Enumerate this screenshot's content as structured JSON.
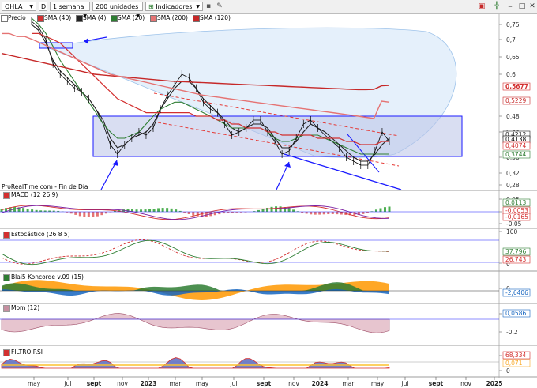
{
  "toolbar": {
    "symbol": "OHLA",
    "d_label": "D",
    "period": "1 semana",
    "units": "200 unidades",
    "indicators": "Indicadores"
  },
  "legend": [
    {
      "label": "Precio",
      "color": "#000000"
    },
    {
      "label": "SMA (40)",
      "color": "#d32f2f"
    },
    {
      "label": "SMA (4)",
      "color": "#222222"
    },
    {
      "label": "SMA (20)",
      "color": "#2e7d32"
    },
    {
      "label": "SMA (200)",
      "color": "#e57373"
    },
    {
      "label": "SMA (120)",
      "color": "#c62828"
    }
  ],
  "source_label": "ProRealTime.com - Fin de Día",
  "x_axis_labels": [
    "may",
    "jul",
    "sept",
    "nov",
    "2023",
    "mar",
    "may",
    "jul",
    "sept",
    "nov",
    "2024",
    "mar",
    "may",
    "jul",
    "sept",
    "nov",
    "2025"
  ],
  "panels": [
    {
      "name": "MACD (12 26 9)",
      "ticks": [
        "0,05",
        "0",
        "-0,05"
      ],
      "values": [
        "0,0113",
        "-0,0053",
        "-0,0165"
      ],
      "value_colors": [
        "#2e7d32",
        "#d32f2f",
        "#d32f2f"
      ]
    },
    {
      "name": "Estocástico (26 8 5)",
      "ticks": [
        "100",
        "0"
      ],
      "values": [
        "37,796",
        "26,743"
      ],
      "value_colors": [
        "#2e7d32",
        "#d32f2f"
      ]
    },
    {
      "name": "Blai5 Koncorde v.09 (15)",
      "ticks": [
        "0"
      ],
      "values": [
        "-2,6406"
      ],
      "value_colors": [
        "#1565c0"
      ]
    },
    {
      "name": "Mom (12)",
      "ticks": [
        "0",
        "-0,2"
      ],
      "values": [
        "0,0586"
      ],
      "value_colors": [
        "#1565c0"
      ]
    },
    {
      "name": "FILTRO RSI",
      "ticks": [
        "50",
        "0"
      ],
      "values": [
        "68,334",
        "0,071"
      ],
      "value_colors": [
        "#d32f2f",
        "#f9a825"
      ]
    }
  ],
  "colors": {
    "accent": "#1a1aff",
    "sma40": "#d32f2f",
    "sma20": "#2e7d32",
    "price": "#000000"
  },
  "chart_data": {
    "type": "line",
    "y_ticks": [
      0.75,
      0.7,
      0.65,
      0.6,
      0.48,
      0.44,
      0.36,
      0.32,
      0.28
    ],
    "y_tick_labels": [
      "0,75",
      "0,7",
      "0,65",
      "0,6",
      "0,48",
      "0,44",
      "0,36",
      "0,32",
      "0,28"
    ],
    "ylim": [
      0.25,
      0.78
    ],
    "last_value_labels": [
      {
        "label": "0,5677",
        "color": "#d32f2f"
      },
      {
        "label": "0,5229",
        "color": "#c62828"
      },
      {
        "label": "0,4212",
        "color": "#222222"
      },
      {
        "label": "0,4138",
        "color": "#000000"
      },
      {
        "label": "0,4074",
        "color": "#d32f2f"
      },
      {
        "label": "0,3744",
        "color": "#2e7d32"
      }
    ],
    "series": [
      {
        "name": "Precio",
        "values": [
          0.76,
          0.74,
          0.7,
          0.63,
          0.6,
          0.58,
          0.56,
          0.55,
          0.53,
          0.5,
          0.46,
          0.4,
          0.37,
          0.4,
          0.42,
          0.44,
          0.43,
          0.45,
          0.5,
          0.54,
          0.57,
          0.6,
          0.59,
          0.56,
          0.52,
          0.5,
          0.49,
          0.46,
          0.43,
          0.44,
          0.45,
          0.47,
          0.47,
          0.44,
          0.41,
          0.37,
          0.38,
          0.42,
          0.46,
          0.47,
          0.45,
          0.43,
          0.41,
          0.39,
          0.36,
          0.35,
          0.34,
          0.34,
          0.38,
          0.44,
          0.41
        ]
      },
      {
        "name": "SMA (4)",
        "values": [
          0.75,
          0.73,
          0.69,
          0.64,
          0.61,
          0.59,
          0.57,
          0.55,
          0.53,
          0.5,
          0.47,
          0.42,
          0.39,
          0.4,
          0.42,
          0.43,
          0.44,
          0.46,
          0.5,
          0.53,
          0.56,
          0.58,
          0.58,
          0.56,
          0.53,
          0.51,
          0.49,
          0.47,
          0.45,
          0.44,
          0.45,
          0.46,
          0.46,
          0.45,
          0.42,
          0.39,
          0.39,
          0.41,
          0.44,
          0.46,
          0.45,
          0.44,
          0.42,
          0.4,
          0.38,
          0.36,
          0.35,
          0.35,
          0.37,
          0.4,
          0.42
        ]
      },
      {
        "name": "SMA (20)",
        "values": [
          0.77,
          0.75,
          0.72,
          0.68,
          0.64,
          0.61,
          0.58,
          0.55,
          0.52,
          0.49,
          0.46,
          0.44,
          0.42,
          0.42,
          0.43,
          0.44,
          0.46,
          0.48,
          0.5,
          0.51,
          0.52,
          0.52,
          0.51,
          0.5,
          0.49,
          0.48,
          0.47,
          0.46,
          0.45,
          0.45,
          0.45,
          0.45,
          0.45,
          0.44,
          0.42,
          0.41,
          0.41,
          0.42,
          0.43,
          0.43,
          0.43,
          0.42,
          0.41,
          0.4,
          0.39,
          0.38,
          0.37,
          0.37,
          0.37,
          0.37,
          0.37
        ]
      },
      {
        "name": "SMA (40)",
        "values": [
          0.72,
          0.72,
          0.71,
          0.7,
          0.69,
          0.67,
          0.65,
          0.63,
          0.61,
          0.59,
          0.57,
          0.55,
          0.53,
          0.52,
          0.51,
          0.5,
          0.49,
          0.49,
          0.49,
          0.49,
          0.49,
          0.49,
          0.49,
          0.48,
          0.48,
          0.48,
          0.47,
          0.47,
          0.46,
          0.46,
          0.45,
          0.45,
          0.45,
          0.44,
          0.44,
          0.43,
          0.43,
          0.43,
          0.43,
          0.43,
          0.42,
          0.42,
          0.42,
          0.42,
          0.41,
          0.41,
          0.4,
          0.4,
          0.4,
          0.41,
          0.41
        ]
      },
      {
        "name": "SMA (120)",
        "values": [
          0.66,
          0.655,
          0.65,
          0.645,
          0.64,
          0.635,
          0.63,
          0.625,
          0.62,
          0.615,
          0.61,
          0.605,
          0.6,
          0.598,
          0.596,
          0.594,
          0.592,
          0.59,
          0.588,
          0.586,
          0.584,
          0.582,
          0.58,
          0.579,
          0.578,
          0.577,
          0.576,
          0.575,
          0.574,
          0.573,
          0.572,
          0.571,
          0.57,
          0.569,
          0.568,
          0.567,
          0.566,
          0.565,
          0.564,
          0.563,
          0.562,
          0.561,
          0.56,
          0.559,
          0.558,
          0.557,
          0.556,
          0.556,
          0.557,
          0.567,
          0.568
        ]
      },
      {
        "name": "SMA (200)",
        "values": [
          0.72,
          0.72,
          0.71,
          0.71,
          0.7,
          0.69,
          0.68,
          0.67,
          0.66,
          0.65,
          0.64,
          0.63,
          0.62,
          0.61,
          0.6,
          0.595,
          0.59,
          0.585,
          0.58,
          0.575,
          0.57,
          0.565,
          0.56,
          0.555,
          0.55,
          0.545,
          0.54,
          0.537,
          0.534,
          0.531,
          0.528,
          0.525,
          0.522,
          0.519,
          0.516,
          0.513,
          0.51,
          0.507,
          0.504,
          0.501,
          0.498,
          0.495,
          0.492,
          0.489,
          0.486,
          0.483,
          0.48,
          0.477,
          0.474,
          0.523,
          0.52
        ]
      }
    ]
  }
}
